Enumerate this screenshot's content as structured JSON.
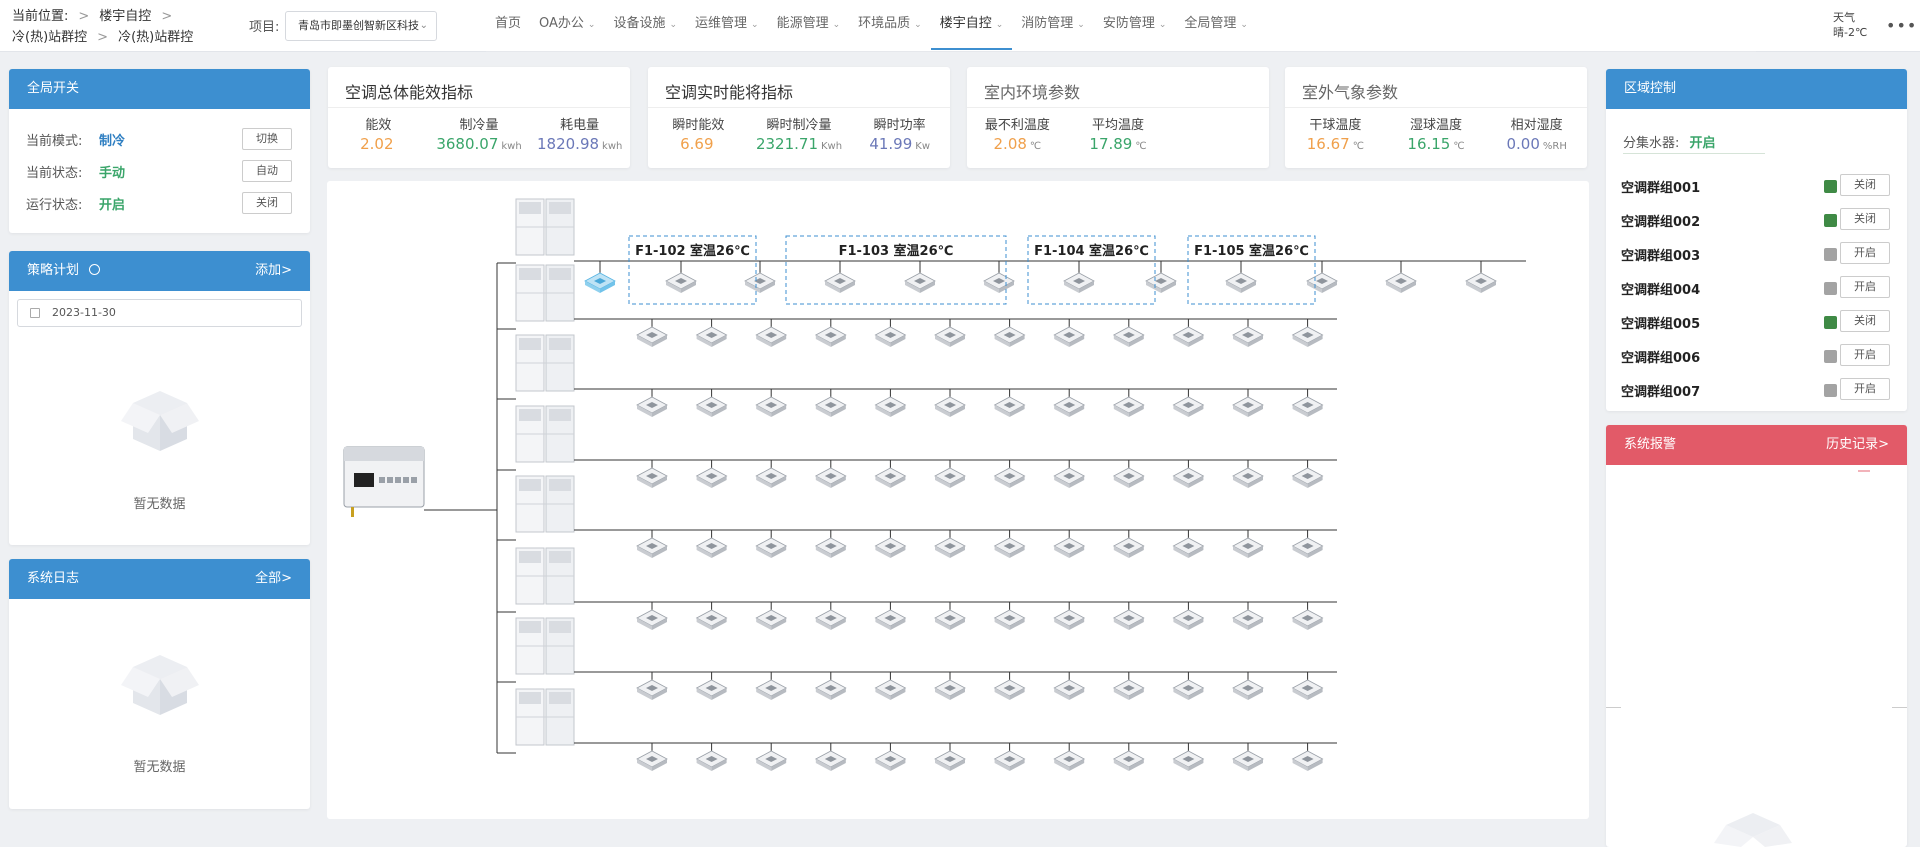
{
  "header": {
    "breadcrumb_label": "当前位置:",
    "crumb_1": "楼宇自控",
    "crumb_2": "冷(热)站群控",
    "crumb_3": "冷(热)站群控",
    "project_label": "项目:",
    "project_value": "青岛市即墨创智新区科技",
    "nav": [
      {
        "label": "首页",
        "has_menu": false
      },
      {
        "label": "OA办公",
        "has_menu": true
      },
      {
        "label": "设备设施",
        "has_menu": true
      },
      {
        "label": "运维管理",
        "has_menu": true
      },
      {
        "label": "能源管理",
        "has_menu": true
      },
      {
        "label": "环境品质",
        "has_menu": true
      },
      {
        "label": "楼宇自控",
        "has_menu": true
      },
      {
        "label": "消防管理",
        "has_menu": true
      },
      {
        "label": "安防管理",
        "has_menu": true
      },
      {
        "label": "全局管理",
        "has_menu": true
      }
    ],
    "weather_label": "天气",
    "weather_value": "晴-2℃",
    "more": "•••"
  },
  "global_switch": {
    "title": "全局开关",
    "mode_label": "当前模式:",
    "mode_value": "制冷",
    "mode_btn": "切换",
    "state_label": "当前状态:",
    "state_value": "手动",
    "state_btn": "自动",
    "run_label": "运行状态:",
    "run_value": "开启",
    "run_btn": "关闭"
  },
  "strategy": {
    "title": "策略计划",
    "add": "添加>",
    "date": "2023-11-30",
    "empty": "暂无数据"
  },
  "syslog": {
    "title": "系统日志",
    "all": "全部>",
    "empty": "暂无数据"
  },
  "cards": [
    {
      "title": "空调总体能效指标",
      "items": [
        {
          "label": "能效",
          "value": "2.02",
          "unit": "",
          "color": "#f0a04b"
        },
        {
          "label": "制冷量",
          "value": "3680.07",
          "unit": "kwh",
          "color": "#3aa56a"
        },
        {
          "label": "耗电量",
          "value": "1820.98",
          "unit": "kwh",
          "color": "#6b78b8"
        }
      ]
    },
    {
      "title": "空调实时能将指标",
      "items": [
        {
          "label": "瞬时能效",
          "value": "6.69",
          "unit": "",
          "color": "#f0a04b"
        },
        {
          "label": "瞬时制冷量",
          "value": "2321.71",
          "unit": "Kwh",
          "color": "#3aa56a"
        },
        {
          "label": "瞬时功率",
          "value": "41.99",
          "unit": "Kw",
          "color": "#6b78b8"
        }
      ]
    },
    {
      "title": "室内环境参数",
      "items": [
        {
          "label": "最不利温度",
          "value": "2.08",
          "unit": "℃",
          "color": "#f0a04b"
        },
        {
          "label": "平均温度",
          "value": "17.89",
          "unit": "℃",
          "color": "#3aa56a"
        }
      ]
    },
    {
      "title": "室外气象参数",
      "items": [
        {
          "label": "干球温度",
          "value": "16.67",
          "unit": "℃",
          "color": "#f0a04b"
        },
        {
          "label": "湿球温度",
          "value": "16.15",
          "unit": "℃",
          "color": "#3aa56a"
        },
        {
          "label": "相对湿度",
          "value": "0.00",
          "unit": "%RH",
          "color": "#6b78b8"
        }
      ]
    }
  ],
  "diagram": {
    "rooms": [
      {
        "label": "F1-102 室温26℃"
      },
      {
        "label": "F1-103 室温26℃"
      },
      {
        "label": "F1-104 室温26℃"
      },
      {
        "label": "F1-105 室温26℃"
      }
    ]
  },
  "zone": {
    "title": "区域控制",
    "collector_label": "分集水器:",
    "collector_value": "开启",
    "groups": [
      {
        "name": "空调群组001",
        "on": true,
        "btn": "关闭"
      },
      {
        "name": "空调群组002",
        "on": true,
        "btn": "关闭"
      },
      {
        "name": "空调群组003",
        "on": false,
        "btn": "开启"
      },
      {
        "name": "空调群组004",
        "on": false,
        "btn": "开启"
      },
      {
        "name": "空调群组005",
        "on": true,
        "btn": "关闭"
      },
      {
        "name": "空调群组006",
        "on": false,
        "btn": "开启"
      },
      {
        "name": "空调群组007",
        "on": false,
        "btn": "开启"
      }
    ],
    "on_color": "#3f8a45",
    "off_color": "#a3a3a3"
  },
  "alarm": {
    "title": "系统报警",
    "history": "历史记录>"
  },
  "colors": {
    "primary": "#3d8fd0",
    "alarm": "#e25a68",
    "blue_value": "#2f7fc2",
    "green_value": "#3aa56a"
  }
}
